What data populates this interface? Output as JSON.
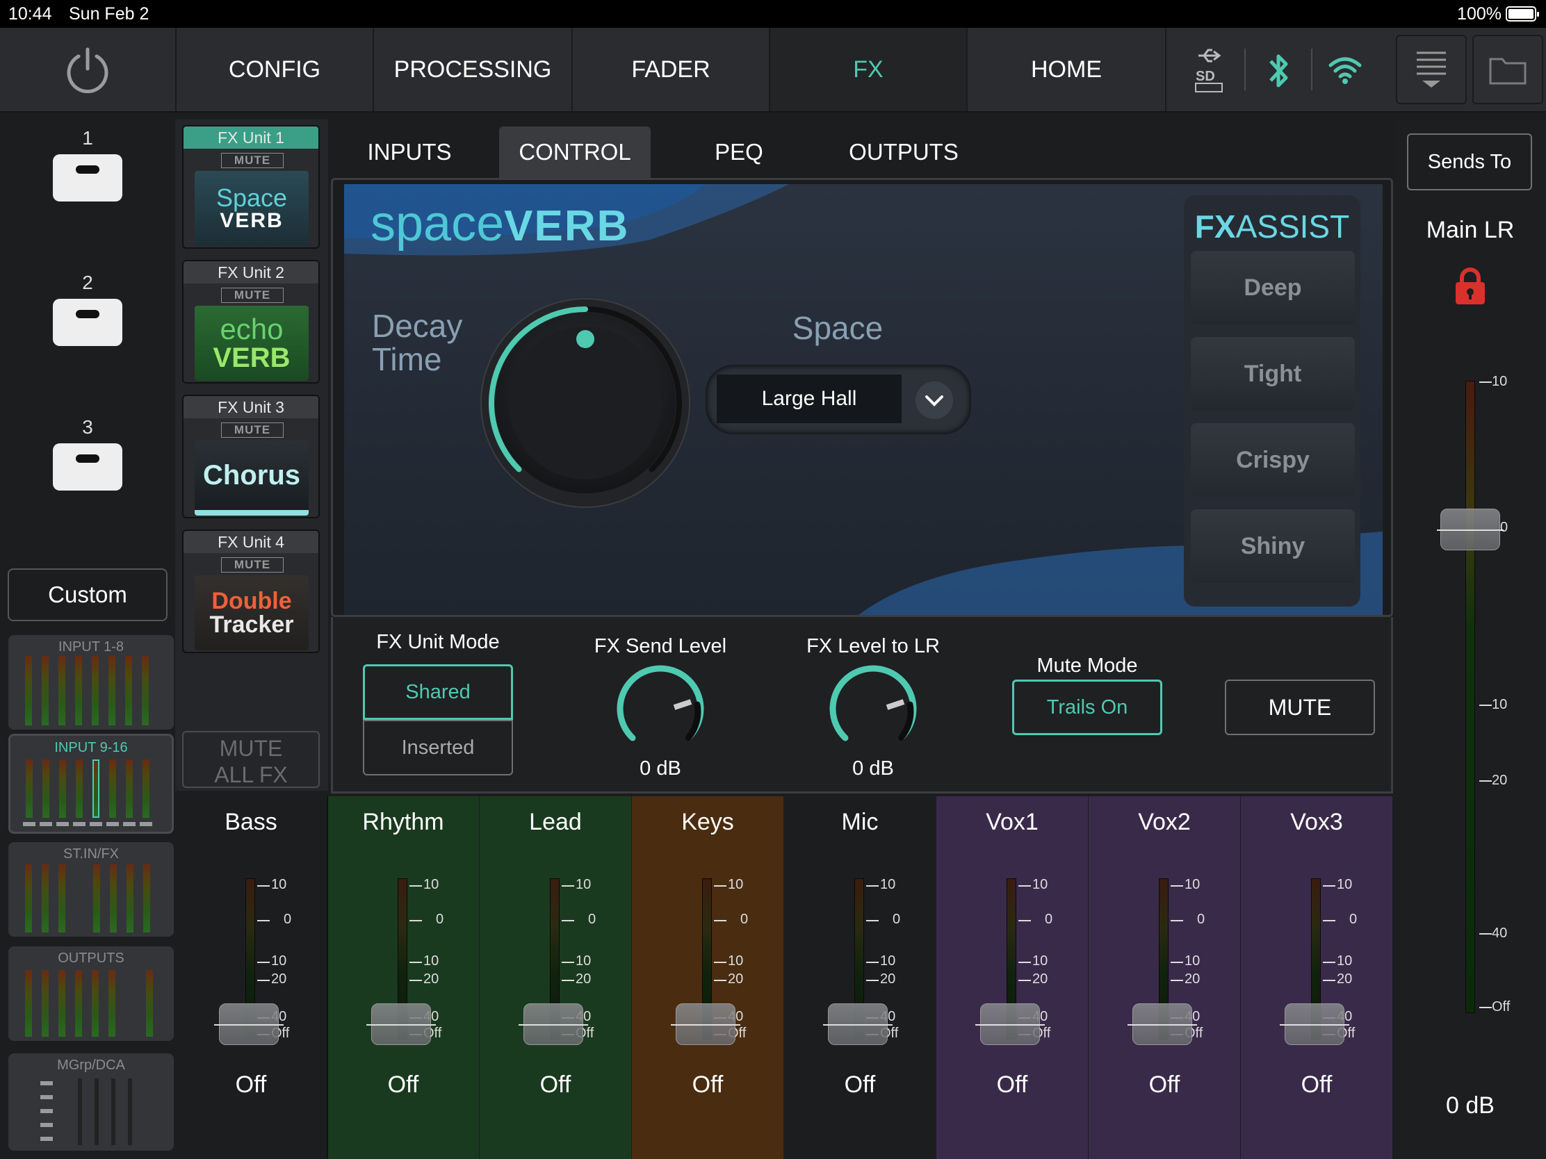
{
  "status": {
    "time": "10:44",
    "date": "Sun Feb 2",
    "battery": "100%"
  },
  "nav": {
    "tabs": [
      "CONFIG",
      "PROCESSING",
      "FADER",
      "FX",
      "HOME"
    ],
    "active": "FX"
  },
  "scenes": [
    "1",
    "2",
    "3"
  ],
  "custom_label": "Custom",
  "layers": [
    "INPUT 1-8",
    "INPUT 9-16",
    "ST.IN/FX",
    "OUTPUTS",
    "MGrp/DCA"
  ],
  "fx_units": [
    {
      "head": "FX Unit 1",
      "mute": "MUTE",
      "logo_line1": "Space",
      "logo_line2": "VERB"
    },
    {
      "head": "FX Unit 2",
      "mute": "MUTE",
      "logo_line1": "echo",
      "logo_line2": "VERB"
    },
    {
      "head": "FX Unit 3",
      "mute": "MUTE",
      "logo_line1": "Chorus",
      "logo_line2": ""
    },
    {
      "head": "FX Unit 4",
      "mute": "MUTE",
      "logo_line1": "Double",
      "logo_line2": "Tracker"
    }
  ],
  "mute_all_fx": {
    "line1": "MUTE",
    "line2": "ALL FX"
  },
  "sub_tabs": [
    "INPUTS",
    "CONTROL",
    "PEQ",
    "OUTPUTS"
  ],
  "sub_tab_active": "CONTROL",
  "plugin": {
    "logo_light": "space",
    "logo_bold": "VERB",
    "decay_label_1": "Decay",
    "decay_label_2": "Time",
    "decay_level": 0.5,
    "space_label": "Space",
    "space_value": "Large Hall",
    "fxassist_bold": "FX",
    "fxassist_light": "ASSIST",
    "presets": [
      "Deep",
      "Tight",
      "Crispy",
      "Shiny"
    ]
  },
  "controls": {
    "unit_mode_label": "FX Unit Mode",
    "unit_mode_options": [
      "Shared",
      "Inserted"
    ],
    "send_level_label": "FX Send Level",
    "send_level_value": "0 dB",
    "level_lr_label": "FX Level to LR",
    "level_lr_value": "0 dB",
    "mute_mode_label": "Mute Mode",
    "mute_mode_value": "Trails On",
    "mute_button": "MUTE"
  },
  "right_panel": {
    "sends_to": "Sends To",
    "main_lr": "Main LR",
    "value": "0 dB",
    "scale": [
      "10",
      "0",
      "10",
      "20",
      "40",
      "Off"
    ]
  },
  "strips": [
    {
      "name": "Bass",
      "value": "Off",
      "color": "#1c1d1f"
    },
    {
      "name": "Rhythm",
      "value": "Off",
      "color": "#1a3a1f"
    },
    {
      "name": "Lead",
      "value": "Off",
      "color": "#1a3a1f"
    },
    {
      "name": "Keys",
      "value": "Off",
      "color": "#4a2c10"
    },
    {
      "name": "Mic",
      "value": "Off",
      "color": "#1c1d1f"
    },
    {
      "name": "Vox1",
      "value": "Off",
      "color": "#3a2a4a"
    },
    {
      "name": "Vox2",
      "value": "Off",
      "color": "#3a2a4a"
    },
    {
      "name": "Vox3",
      "value": "Off",
      "color": "#3a2a4a"
    }
  ],
  "strip_scale": [
    "10",
    "0",
    "10",
    "20",
    "40",
    "Off"
  ],
  "colors": {
    "accent": "#4ecab1",
    "lock": "#d9312b"
  }
}
